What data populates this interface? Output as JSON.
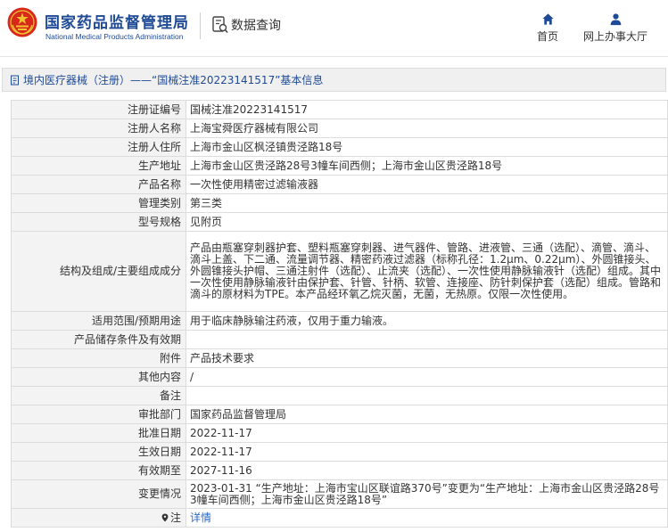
{
  "header": {
    "org_name_cn": "国家药品监督管理局",
    "org_name_en": "National Medical Products Administration",
    "data_query": "数据查询",
    "nav_home": "首页",
    "nav_service": "网上办事大厅"
  },
  "breadcrumb": {
    "text": "境内医疗器械（注册）——“国械注准20223141517”基本信息"
  },
  "rows": [
    {
      "label": "注册证编号",
      "value": "国械注准20223141517"
    },
    {
      "label": "注册人名称",
      "value": "上海宝舜医疗器械有限公司"
    },
    {
      "label": "注册人住所",
      "value": "上海市金山区枫泾镇贵泾路18号"
    },
    {
      "label": "生产地址",
      "value": "上海市金山区贵泾路28号3幢车间西侧；上海市金山区贵泾路18号"
    },
    {
      "label": "产品名称",
      "value": "一次性使用精密过滤输液器"
    },
    {
      "label": "管理类别",
      "value": "第三类"
    },
    {
      "label": "型号规格",
      "value": "见附页"
    },
    {
      "label": "结构及组成/主要组成成分",
      "value": "产品由瓶塞穿刺器护套、塑料瓶塞穿刺器、进气器件、管路、进液管、三通（选配）、滴管、滴斗、滴斗上盖、下二通、流量调节器、精密药液过滤器（标称孔径：1.2μm、0.22μm）、外圆锥接头、外圆锥接头护帽、三通注射件（选配）、止流夹（选配）、一次性使用静脉输液针（选配）组成。其中一次性使用静脉输液针由保护套、针管、针柄、软管、连接座、防针刺保护套（选配）组成。管路和滴斗的原材料为TPE。本产品经环氧乙烷灭菌，无菌，无热原。仅限一次性使用。"
    },
    {
      "label": "适用范围/预期用途",
      "value": "用于临床静脉输注药液，仅用于重力输液。"
    },
    {
      "label": "产品储存条件及有效期",
      "value": ""
    },
    {
      "label": "附件",
      "value": "产品技术要求"
    },
    {
      "label": "其他内容",
      "value": "/"
    },
    {
      "label": "备注",
      "value": ""
    },
    {
      "label": "审批部门",
      "value": "国家药品监督管理局"
    },
    {
      "label": "批准日期",
      "value": "2022-11-17"
    },
    {
      "label": "生效日期",
      "value": "2022-11-17"
    },
    {
      "label": "有效期至",
      "value": "2027-11-16"
    },
    {
      "label": "变更情况",
      "value": "2023-01-31 “生产地址：上海市宝山区联谊路370号”变更为“生产地址：上海市金山区贵泾路28号3幢车间西侧；上海市金山区贵泾路18号”"
    },
    {
      "label": "注",
      "value": "详情"
    }
  ],
  "colors": {
    "brand_blue": "#1e4a96",
    "link_blue": "#2a6bc4",
    "logo_red": "#d7281c",
    "logo_gold": "#f2c230"
  }
}
